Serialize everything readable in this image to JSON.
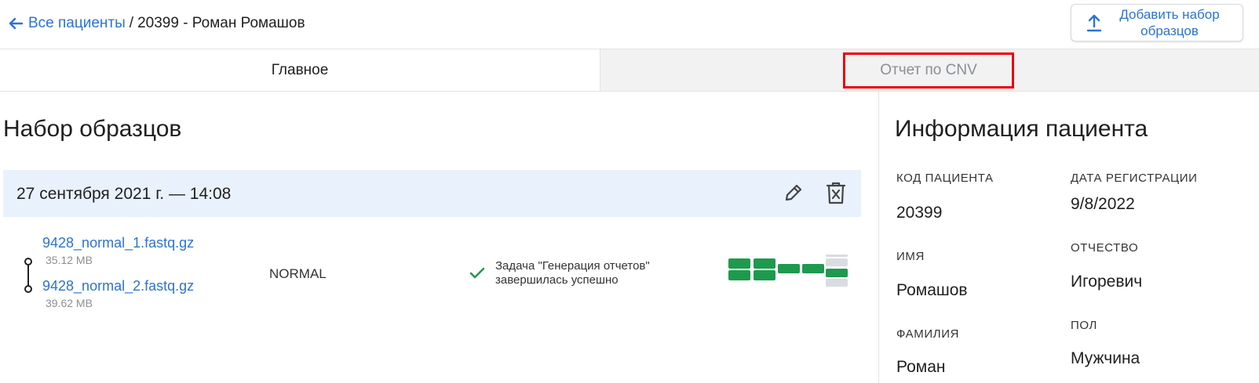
{
  "header": {
    "back_link": "Все пациенты",
    "separator": "/",
    "current": "20399 - Роман Ромашов",
    "add_button_label": "Добавить набор образцов"
  },
  "tabs": [
    {
      "label": "Главное",
      "active": true
    },
    {
      "label": "Отчет по CNV",
      "active": false,
      "highlighted": true
    }
  ],
  "samples": {
    "title": "Набор образцов",
    "set_date": "27 сентября 2021 г. — 14:08",
    "files": [
      {
        "name": "9428_normal_1.fastq.gz",
        "size": "35.12 MB"
      },
      {
        "name": "9428_normal_2.fastq.gz",
        "size": "39.62 MB"
      }
    ],
    "type": "NORMAL",
    "status_line1": "Задача \"Генерация отчетов\"",
    "status_line2": "завершилась успешно"
  },
  "patient": {
    "title": "Информация пациента",
    "code_label": "КОД ПАЦИЕНТА",
    "code_value": "20399",
    "reg_label": "ДАТА РЕГИСТРАЦИИ",
    "reg_value": "9/8/2022",
    "name_label": "ИМЯ",
    "name_value": "Ромашов",
    "patronymic_label": "ОТЧЕСТВО",
    "patronymic_value": "Игоревич",
    "surname_label": "ФАМИЛИЯ",
    "surname_value": "Роман",
    "sex_label": "ПОЛ",
    "sex_value": "Мужчина"
  },
  "colors": {
    "link": "#2c73d2",
    "success": "#1e9a4e",
    "highlight": "#e8000b",
    "set_bg": "#e9f1fc"
  }
}
